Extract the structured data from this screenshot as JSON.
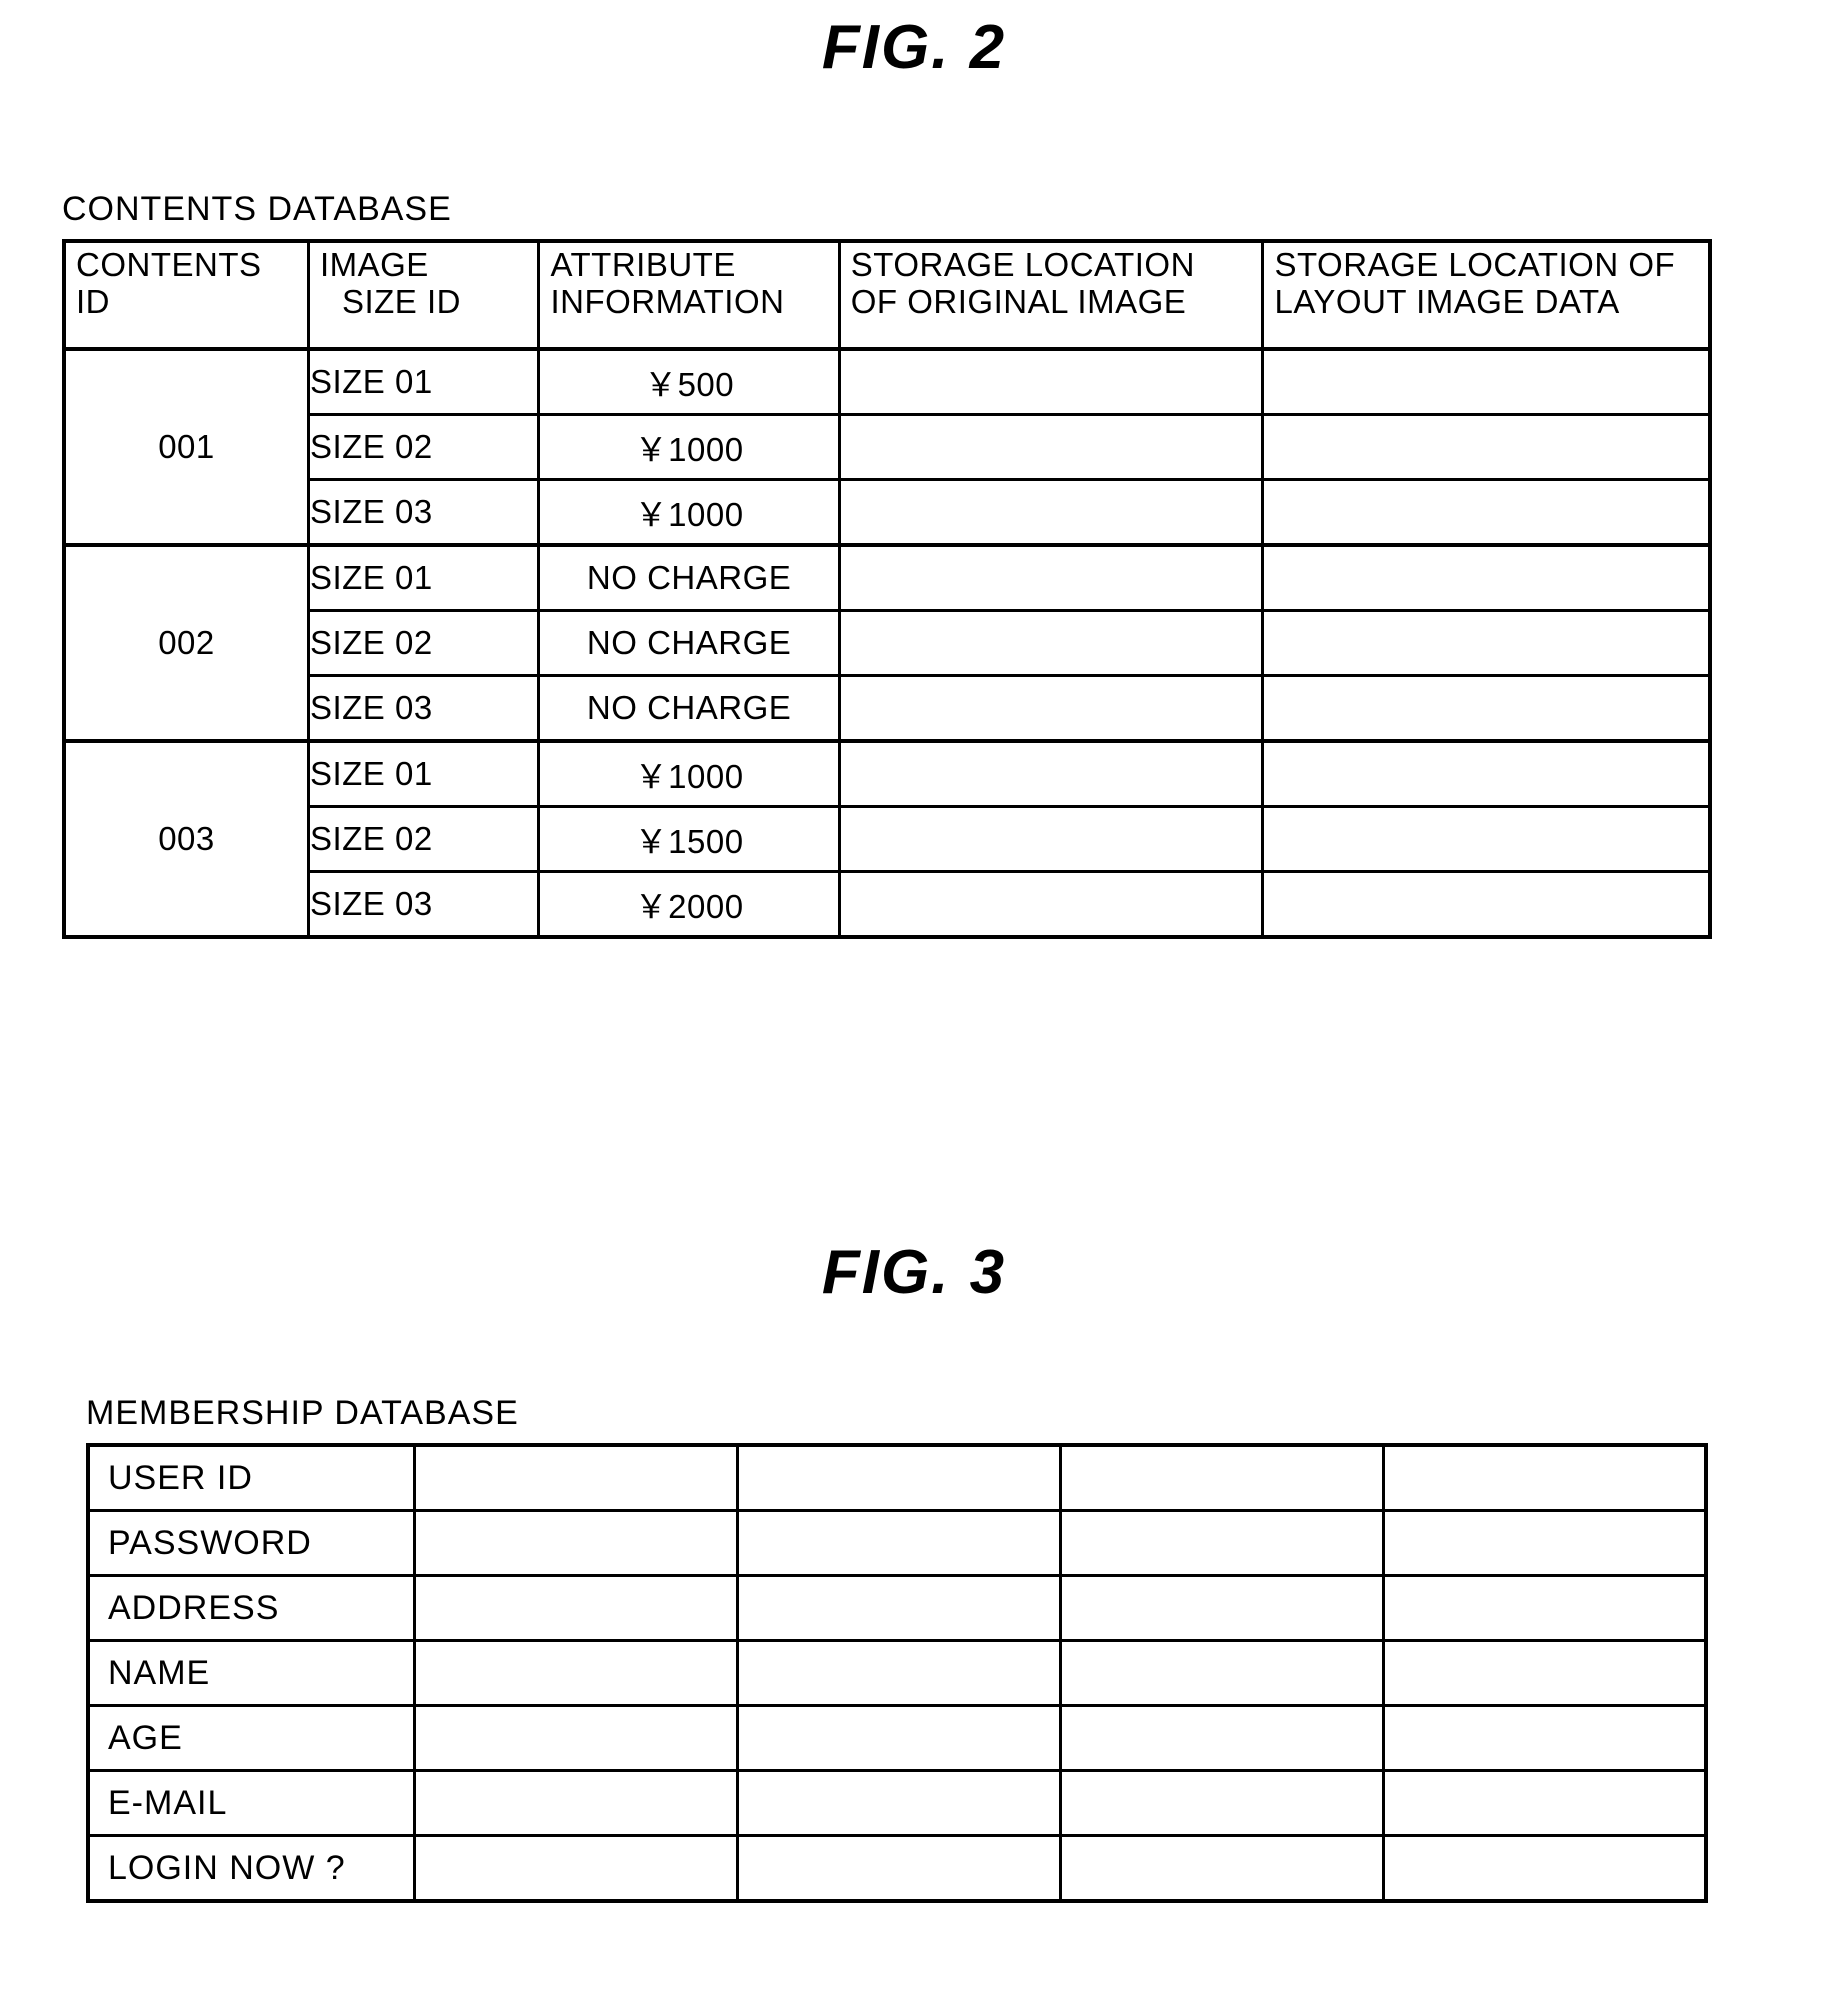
{
  "figures": [
    {
      "title": "FIG.  2",
      "caption": "CONTENTS DATABASE"
    },
    {
      "title": "FIG.  3",
      "caption": "MEMBERSHIP DATABASE"
    }
  ],
  "contents_database": {
    "title": "FIG.  2",
    "caption": "CONTENTS DATABASE",
    "headers": [
      {
        "line1": "CONTENTS",
        "line2": "ID"
      },
      {
        "line1": "IMAGE",
        "line2": "SIZE ID"
      },
      {
        "line1": "ATTRIBUTE",
        "line2": "INFORMATION"
      },
      {
        "line1": "STORAGE LOCATION",
        "line2": "OF ORIGINAL IMAGE"
      },
      {
        "line1": "STORAGE LOCATION OF",
        "line2": "LAYOUT IMAGE DATA"
      }
    ],
    "groups": [
      {
        "contents_id": "001",
        "rows": [
          {
            "image_size_id": "SIZE 01",
            "attribute_information": "￥500",
            "storage_location_original": "",
            "storage_location_layout": ""
          },
          {
            "image_size_id": "SIZE 02",
            "attribute_information": "￥1000",
            "storage_location_original": "",
            "storage_location_layout": ""
          },
          {
            "image_size_id": "SIZE 03",
            "attribute_information": "￥1000",
            "storage_location_original": "",
            "storage_location_layout": ""
          }
        ]
      },
      {
        "contents_id": "002",
        "rows": [
          {
            "image_size_id": "SIZE 01",
            "attribute_information": "NO CHARGE",
            "storage_location_original": "",
            "storage_location_layout": ""
          },
          {
            "image_size_id": "SIZE 02",
            "attribute_information": "NO CHARGE",
            "storage_location_original": "",
            "storage_location_layout": ""
          },
          {
            "image_size_id": "SIZE 03",
            "attribute_information": "NO CHARGE",
            "storage_location_original": "",
            "storage_location_layout": ""
          }
        ]
      },
      {
        "contents_id": "003",
        "rows": [
          {
            "image_size_id": "SIZE 01",
            "attribute_information": "￥1000",
            "storage_location_original": "",
            "storage_location_layout": ""
          },
          {
            "image_size_id": "SIZE 02",
            "attribute_information": "￥1500",
            "storage_location_original": "",
            "storage_location_layout": ""
          },
          {
            "image_size_id": "SIZE 03",
            "attribute_information": "￥2000",
            "storage_location_original": "",
            "storage_location_layout": ""
          }
        ]
      }
    ]
  },
  "membership_database": {
    "title": "FIG.  3",
    "caption": "MEMBERSHIP DATABASE",
    "field_labels": [
      "USER ID",
      "PASSWORD",
      "ADDRESS",
      "NAME",
      "AGE",
      "E-MAIL",
      "LOGIN NOW ?"
    ],
    "data_column_count": 4,
    "values": [
      [
        "",
        "",
        "",
        ""
      ],
      [
        "",
        "",
        "",
        ""
      ],
      [
        "",
        "",
        "",
        ""
      ],
      [
        "",
        "",
        "",
        ""
      ],
      [
        "",
        "",
        "",
        ""
      ],
      [
        "",
        "",
        "",
        ""
      ],
      [
        "",
        "",
        "",
        ""
      ]
    ]
  }
}
